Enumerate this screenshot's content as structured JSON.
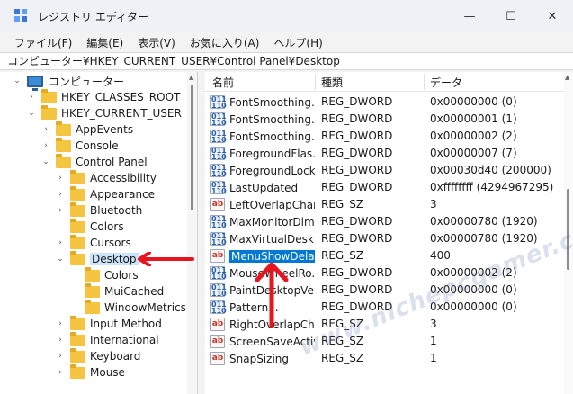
{
  "window": {
    "title": "レジストリ エディター",
    "controls": {
      "minimize": "—",
      "maximize": "☐",
      "close": "✕"
    }
  },
  "menu": [
    "ファイル(F)",
    "編集(E)",
    "表示(V)",
    "お気に入り(A)",
    "ヘルプ(H)"
  ],
  "address": "コンピューター¥HKEY_CURRENT_USER¥Control Panel¥Desktop",
  "tree": [
    {
      "label": "コンピューター",
      "chevron": "⌄",
      "icon": "computer-icon"
    },
    {
      "label": "HKEY_CLASSES_ROOT",
      "chevron": "›",
      "icon": "folder-icon"
    },
    {
      "label": "HKEY_CURRENT_USER",
      "chevron": "⌄",
      "icon": "folder-icon"
    },
    {
      "label": "AppEvents",
      "chevron": "›",
      "icon": "folder-icon"
    },
    {
      "label": "Console",
      "chevron": "›",
      "icon": "folder-icon"
    },
    {
      "label": "Control Panel",
      "chevron": "⌄",
      "icon": "folder-icon"
    },
    {
      "label": "Accessibility",
      "chevron": "›",
      "icon": "folder-icon"
    },
    {
      "label": "Appearance",
      "chevron": "›",
      "icon": "folder-icon"
    },
    {
      "label": "Bluetooth",
      "chevron": "›",
      "icon": "folder-icon"
    },
    {
      "label": "Colors",
      "chevron": "",
      "icon": "folder-icon"
    },
    {
      "label": "Cursors",
      "chevron": "›",
      "icon": "folder-icon"
    },
    {
      "label": "Desktop",
      "chevron": "⌄",
      "icon": "folder-icon",
      "selected": true
    },
    {
      "label": "Colors",
      "chevron": "",
      "icon": "folder-icon"
    },
    {
      "label": "MuiCached",
      "chevron": "",
      "icon": "folder-icon"
    },
    {
      "label": "WindowMetrics",
      "chevron": "",
      "icon": "folder-icon"
    },
    {
      "label": "Input Method",
      "chevron": "›",
      "icon": "folder-icon"
    },
    {
      "label": "International",
      "chevron": "›",
      "icon": "folder-icon"
    },
    {
      "label": "Keyboard",
      "chevron": "›",
      "icon": "folder-icon"
    },
    {
      "label": "Mouse",
      "chevron": "›",
      "icon": "folder-icon"
    }
  ],
  "list": {
    "headers": {
      "name": "名前",
      "type": "種類",
      "data": "データ"
    },
    "rows": [
      {
        "name": "FontSmoothing...",
        "type": "REG_DWORD",
        "data": "0x00000000 (0)",
        "icon": "dword"
      },
      {
        "name": "FontSmoothing...",
        "type": "REG_DWORD",
        "data": "0x00000001 (1)",
        "icon": "dword"
      },
      {
        "name": "FontSmoothing...",
        "type": "REG_DWORD",
        "data": "0x00000002 (2)",
        "icon": "dword"
      },
      {
        "name": "ForegroundFlas...",
        "type": "REG_DWORD",
        "data": "0x00000007 (7)",
        "icon": "dword"
      },
      {
        "name": "ForegroundLock...",
        "type": "REG_DWORD",
        "data": "0x00030d40 (200000)",
        "icon": "dword"
      },
      {
        "name": "LastUpdated",
        "type": "REG_DWORD",
        "data": "0xffffffff (4294967295)",
        "icon": "dword"
      },
      {
        "name": "LeftOverlapChars",
        "type": "REG_SZ",
        "data": "3",
        "icon": "sz"
      },
      {
        "name": "MaxMonitorDim...",
        "type": "REG_DWORD",
        "data": "0x00000780 (1920)",
        "icon": "dword"
      },
      {
        "name": "MaxVirtualDeskt...",
        "type": "REG_DWORD",
        "data": "0x00000780 (1920)",
        "icon": "dword"
      },
      {
        "name": "MenuShowDelay",
        "type": "REG_SZ",
        "data": "400",
        "icon": "sz",
        "selected": true
      },
      {
        "name": "MouseWheelRo...",
        "type": "REG_DWORD",
        "data": "0x00000002 (2)",
        "icon": "dword"
      },
      {
        "name": "PaintDesktopVer...",
        "type": "REG_DWORD",
        "data": "0x00000000 (0)",
        "icon": "dword"
      },
      {
        "name": "Pattern...",
        "type": "REG_DWORD",
        "data": "0x00000000 (0)",
        "icon": "dword"
      },
      {
        "name": "RightOverlapCh...",
        "type": "REG_SZ",
        "data": "3",
        "icon": "sz"
      },
      {
        "name": "ScreenSaveActive",
        "type": "REG_SZ",
        "data": "1",
        "icon": "sz"
      },
      {
        "name": "SnapSizing",
        "type": "REG_SZ",
        "data": "1",
        "icon": "sz"
      }
    ]
  },
  "watermark": "www.nichepcgamer.com",
  "colors": {
    "selection": "#0078d4",
    "tree_selection": "#cce4f7",
    "arrow": "#e8141f"
  }
}
